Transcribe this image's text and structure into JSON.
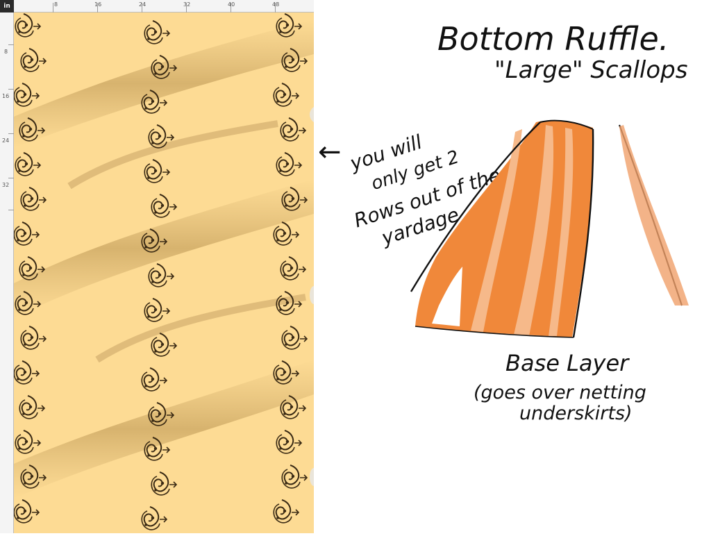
{
  "viewer": {
    "unit_label": "in",
    "ruler_top_ticks": [
      "8",
      "16",
      "24",
      "32",
      "40",
      "48"
    ],
    "ruler_left_ticks": [
      "8",
      "16",
      "24",
      "32"
    ],
    "fabric_color": "#fddb94",
    "motif_color": "#3a2a14",
    "next_arrow": "›"
  },
  "notes": {
    "title": "Bottom Ruffle.",
    "subtitle": "\"Large\" Scallops",
    "arrow": "←",
    "callout_line1": "you will",
    "callout_line2": "only get 2",
    "callout_line3": "Rows out of the",
    "callout_line4": "yardage",
    "base_line1": "Base Layer",
    "base_line2": "(goes over netting",
    "base_line3": "underskirts)",
    "skirt_color": "#f0883a",
    "skirt_light_color": "#f6b98a",
    "ink_color": "#111111"
  }
}
